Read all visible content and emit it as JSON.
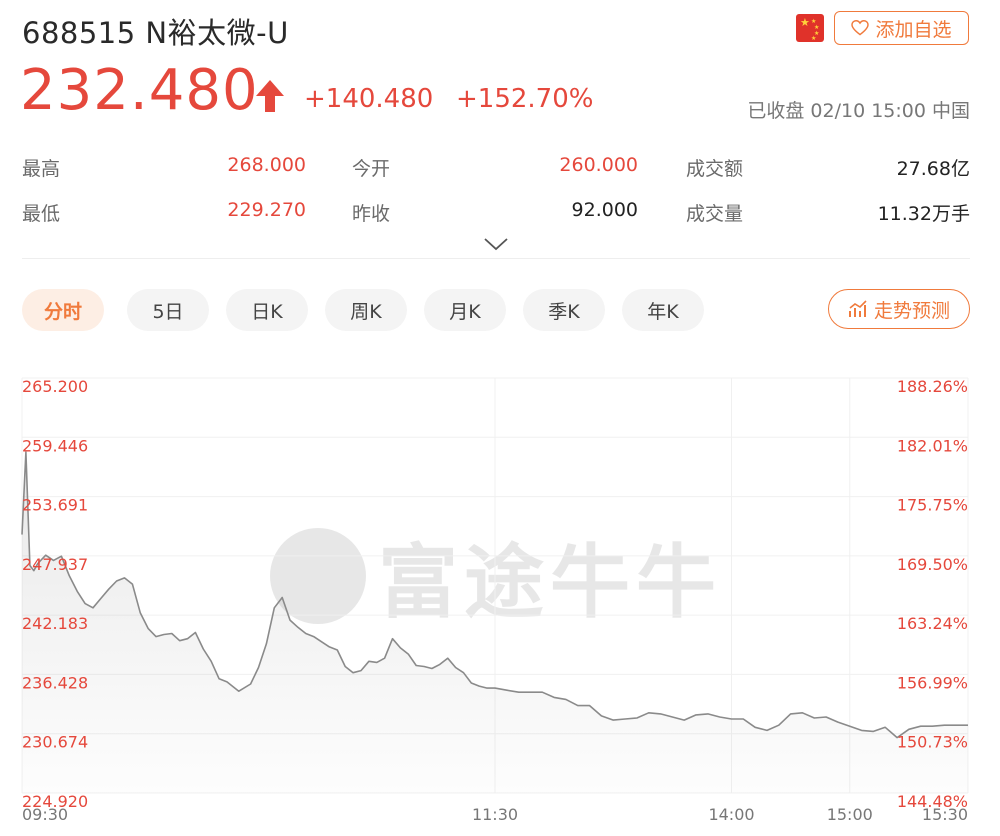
{
  "stock": {
    "title": "688515 N裕太微-U",
    "price": "232.480",
    "change": "+140.480",
    "change_pct": "+152.70%",
    "status": "已收盘 02/10 15:00 中国",
    "add_watchlist_label": "添加自选",
    "market_flag": "cn-flag-icon"
  },
  "stats": [
    {
      "label": "最高",
      "value": "268.000",
      "color": "red"
    },
    {
      "label": "今开",
      "value": "260.000",
      "color": "red"
    },
    {
      "label": "成交额",
      "value": "27.68亿",
      "color": "black"
    },
    {
      "label": "最低",
      "value": "229.270",
      "color": "red"
    },
    {
      "label": "昨收",
      "value": "92.000",
      "color": "black"
    },
    {
      "label": "成交量",
      "value": "11.32万手",
      "color": "black"
    }
  ],
  "tabs": [
    "分时",
    "5日",
    "日K",
    "周K",
    "月K",
    "季K",
    "年K"
  ],
  "active_tab": "分时",
  "predict_label": "走势预测",
  "watermark": "富途牛牛",
  "colors": {
    "up": "#e5483c",
    "accent": "#f07a3c",
    "line": "#8a8a8a"
  },
  "chart_data": {
    "type": "line",
    "y_ticks_left": [
      "265.200",
      "259.446",
      "253.691",
      "247.937",
      "242.183",
      "236.428",
      "230.674",
      "224.920"
    ],
    "y_ticks_right": [
      "188.26%",
      "182.01%",
      "175.75%",
      "169.50%",
      "163.24%",
      "156.99%",
      "150.73%",
      "144.48%"
    ],
    "x_ticks": [
      "09:30",
      "11:30",
      "14:00",
      "15:00",
      "15:30"
    ],
    "ylim": [
      224.92,
      265.2
    ],
    "x_minutes": [
      0,
      1,
      2,
      3,
      4,
      6,
      8,
      10,
      12,
      14,
      16,
      18,
      20,
      22,
      24,
      26,
      28,
      30,
      32,
      34,
      36,
      38,
      40,
      42,
      44,
      46,
      48,
      50,
      52,
      55,
      58,
      60,
      62,
      64,
      66,
      68,
      70,
      72,
      74,
      76,
      78,
      80,
      82,
      84,
      86,
      88,
      90,
      92,
      94,
      96,
      98,
      100,
      102,
      104,
      106,
      108,
      110,
      112,
      114,
      116,
      118,
      120,
      123,
      126,
      129,
      132,
      135,
      138,
      141,
      144,
      147,
      150,
      153,
      156,
      159,
      162,
      165,
      168,
      171,
      174,
      177,
      180,
      183,
      186,
      189,
      192,
      195,
      198,
      201,
      204,
      207,
      210,
      213,
      216,
      219,
      222,
      225,
      228,
      231,
      234,
      236,
      238,
      239,
      240
    ],
    "values": [
      250.0,
      258.0,
      247.0,
      246.5,
      247.2,
      248.0,
      247.5,
      247.9,
      246.0,
      244.5,
      243.3,
      242.9,
      243.8,
      244.7,
      245.5,
      245.8,
      245.2,
      242.4,
      240.9,
      240.1,
      240.3,
      240.4,
      239.7,
      239.9,
      240.5,
      238.9,
      237.7,
      236.0,
      235.7,
      234.8,
      235.5,
      237.1,
      239.4,
      242.9,
      243.9,
      241.7,
      241.0,
      240.4,
      240.1,
      239.6,
      239.1,
      238.8,
      237.2,
      236.6,
      236.8,
      237.7,
      237.6,
      238.0,
      239.9,
      239.0,
      238.4,
      237.3,
      237.2,
      237.0,
      237.4,
      238.0,
      237.1,
      236.6,
      235.6,
      235.3,
      235.1,
      235.1,
      234.9,
      234.7,
      234.7,
      234.7,
      234.2,
      234.0,
      233.4,
      233.4,
      232.4,
      232.0,
      232.1,
      232.2,
      232.7,
      232.6,
      232.3,
      232.0,
      232.5,
      232.6,
      232.3,
      232.1,
      232.1,
      231.3,
      231.0,
      231.5,
      232.6,
      232.7,
      232.2,
      232.3,
      231.8,
      231.4,
      231.0,
      230.9,
      231.3,
      230.3,
      231.1,
      231.4,
      231.4,
      231.5,
      231.5,
      231.5,
      231.5,
      231.5
    ]
  }
}
